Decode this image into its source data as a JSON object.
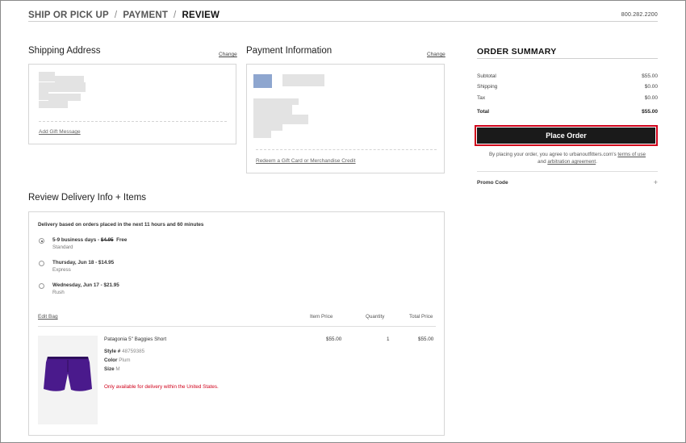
{
  "header": {
    "steps": [
      "SHIP OR PICK UP",
      "PAYMENT",
      "REVIEW"
    ],
    "separator": "/",
    "phone": "800.282.2200"
  },
  "shipping": {
    "title": "Shipping Address",
    "change_label": "Change",
    "gift_link": "Add Gift Message"
  },
  "payment": {
    "title": "Payment Information",
    "change_label": "Change",
    "redeem_link": "Redeem a Gift Card or Merchandise Credit"
  },
  "summary": {
    "title": "ORDER SUMMARY",
    "rows": [
      {
        "label": "Subtotal",
        "value": "$55.00"
      },
      {
        "label": "Shipping",
        "value": "$0.00"
      },
      {
        "label": "Tax",
        "value": "$0.00"
      },
      {
        "label": "Total",
        "value": "$55.00"
      }
    ],
    "place_order": "Place Order",
    "terms_prefix": "By placing your order, you agree to urbanoutfitters.com's",
    "terms_link": "terms of use",
    "terms_and": "and",
    "arbitration_link": "arbitration agreement",
    "terms_suffix": ".",
    "promo_label": "Promo Code",
    "promo_icon": "+"
  },
  "delivery": {
    "title": "Review Delivery Info + Items",
    "note": "Delivery based on orders placed in the next 11 hours and 60 minutes",
    "options": [
      {
        "name": "5-9 business days - ",
        "old_price": "$4.95",
        "price": "Free",
        "type": "Standard",
        "selected": true
      },
      {
        "name": "Thursday, Jun 18 - $14.95",
        "type": "Express",
        "selected": false
      },
      {
        "name": "Wednesday, Jun 17 - $21.95",
        "type": "Rush",
        "selected": false
      }
    ],
    "edit_bag": "Edit Bag",
    "columns": {
      "item_price": "Item Price",
      "quantity": "Quantity",
      "total_price": "Total Price"
    }
  },
  "item": {
    "name": "Patagonia 5\" Baggies Short",
    "style_label": "Style #",
    "style_value": "48759385",
    "color_label": "Color",
    "color_value": "Plum",
    "size_label": "Size",
    "size_value": "M",
    "warning": "Only available for delivery within the United States.",
    "item_price": "$55.00",
    "quantity": "1",
    "total_price": "$55.00",
    "shorts_color": "#4a1a8c"
  }
}
